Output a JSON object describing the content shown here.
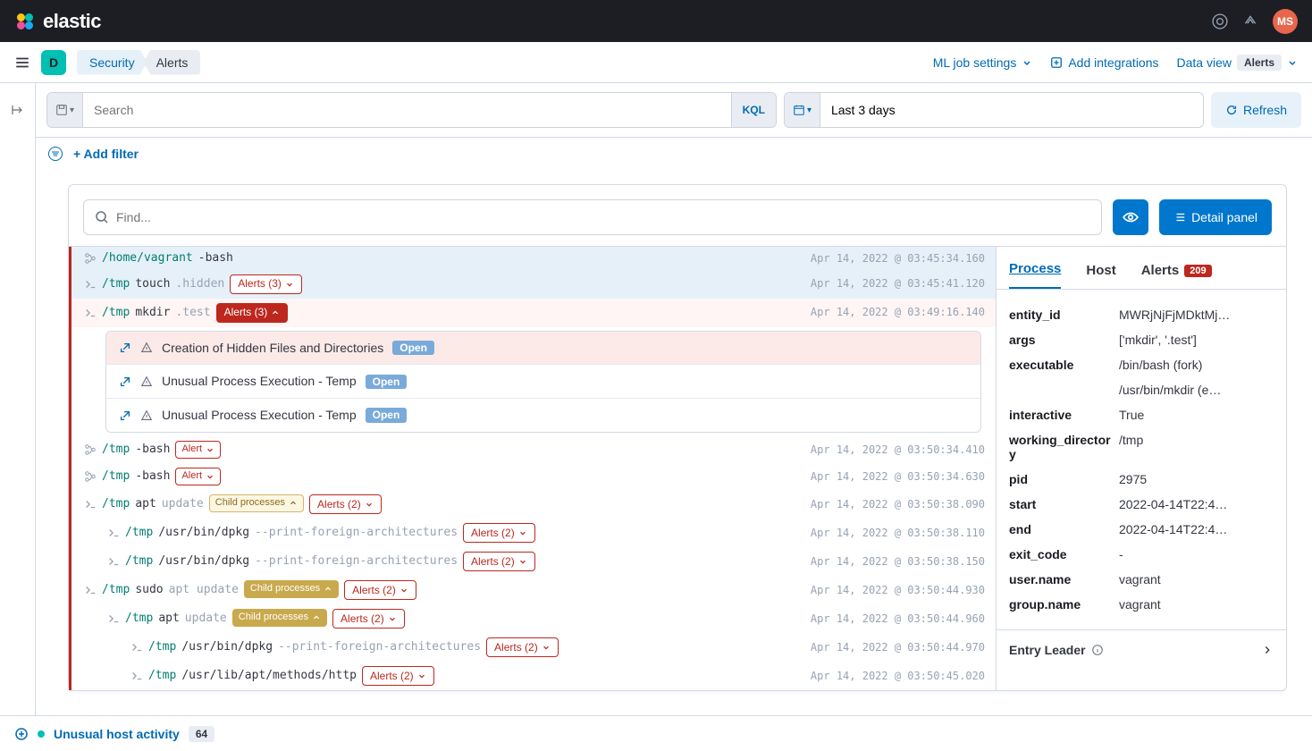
{
  "brand": "elastic",
  "avatar": "MS",
  "space": "D",
  "breadcrumbs": {
    "security": "Security",
    "alerts": "Alerts"
  },
  "header": {
    "ml": "ML job settings",
    "add_int": "Add integrations",
    "data_view": "Data view",
    "data_view_badge": "Alerts"
  },
  "query": {
    "placeholder": "Search",
    "suffix": "KQL",
    "date": "Last 3 days",
    "refresh": "Refresh",
    "add_filter": "+ Add filter"
  },
  "find": {
    "placeholder": "Find...",
    "detail": "Detail panel"
  },
  "rows": [
    {
      "indent": 0,
      "icon": "branch",
      "dir": "/home/vagrant",
      "cmd": "-bash",
      "arg": "",
      "ts": "Apr 14, 2022 @ 03:45:34.160",
      "hov": true
    },
    {
      "indent": 0,
      "icon": "prompt",
      "dir": "/tmp",
      "cmd": "touch",
      "arg": ".hidden",
      "ts": "Apr 14, 2022 @ 03:45:41.120",
      "alerts": "Alerts (3)",
      "alerts_open": true,
      "hov": true
    },
    {
      "indent": 0,
      "icon": "prompt",
      "dir": "/tmp",
      "cmd": "mkdir",
      "arg": ".test",
      "ts": "Apr 14, 2022 @ 03:49:16.140",
      "alerts": "Alerts (3)",
      "alerts_solid": true,
      "sel": true
    },
    {
      "indent": 0,
      "icon": "branch",
      "dir": "/tmp",
      "cmd": "-bash",
      "arg": "",
      "ts": "Apr 14, 2022 @ 03:50:34.410",
      "alert_single": "Alert"
    },
    {
      "indent": 0,
      "icon": "branch",
      "dir": "/tmp",
      "cmd": "-bash",
      "arg": "",
      "ts": "Apr 14, 2022 @ 03:50:34.630",
      "alert_single": "Alert"
    },
    {
      "indent": 0,
      "icon": "prompt",
      "dir": "/tmp",
      "cmd": "apt",
      "arg": "update",
      "ts": "Apr 14, 2022 @ 03:50:38.090",
      "child": "Child processes",
      "alerts": "Alerts (2)"
    },
    {
      "indent": 1,
      "icon": "prompt",
      "dir": "/tmp",
      "cmd": "/usr/bin/dpkg",
      "arg": "--print-foreign-architectures",
      "ts": "Apr 14, 2022 @ 03:50:38.110",
      "alerts": "Alerts (2)"
    },
    {
      "indent": 1,
      "icon": "prompt",
      "dir": "/tmp",
      "cmd": "/usr/bin/dpkg",
      "arg": "--print-foreign-architectures",
      "ts": "Apr 14, 2022 @ 03:50:38.150",
      "alerts": "Alerts (2)"
    },
    {
      "indent": 0,
      "icon": "prompt",
      "dir": "/tmp",
      "cmd": "sudo",
      "arg": "apt update",
      "ts": "Apr 14, 2022 @ 03:50:44.930",
      "child": "Child processes",
      "child_solid": true,
      "alerts": "Alerts (2)"
    },
    {
      "indent": 1,
      "icon": "prompt",
      "dir": "/tmp",
      "cmd": "apt",
      "arg": "update",
      "ts": "Apr 14, 2022 @ 03:50:44.960",
      "child": "Child processes",
      "child_solid": true,
      "alerts": "Alerts (2)"
    },
    {
      "indent": 2,
      "icon": "prompt",
      "dir": "/tmp",
      "cmd": "/usr/bin/dpkg",
      "arg": "--print-foreign-architectures",
      "ts": "Apr 14, 2022 @ 03:50:44.970",
      "alerts": "Alerts (2)"
    },
    {
      "indent": 2,
      "icon": "prompt",
      "dir": "/tmp",
      "cmd": "/usr/lib/apt/methods/http",
      "arg": "",
      "ts": "Apr 14, 2022 @ 03:50:45.020",
      "alerts": "Alerts (2)"
    }
  ],
  "alerts_expanded": [
    {
      "name": "Creation of Hidden Files and Directories",
      "status": "Open",
      "first": true
    },
    {
      "name": "Unusual Process Execution - Temp",
      "status": "Open"
    },
    {
      "name": "Unusual Process Execution - Temp",
      "status": "Open"
    }
  ],
  "detail": {
    "tabs": {
      "process": "Process",
      "host": "Host",
      "alerts": "Alerts",
      "alerts_count": "209"
    },
    "kv": [
      {
        "k": "entity_id",
        "v": "MWRjNjFjMDktMj…"
      },
      {
        "k": "args",
        "v": "['mkdir', '.test']"
      },
      {
        "k": "executable",
        "v": "/bin/bash (fork)"
      },
      {
        "k": "",
        "v": "/usr/bin/mkdir (e…"
      },
      {
        "k": "interactive",
        "v": "True"
      },
      {
        "k": "working_directory",
        "v": "/tmp"
      },
      {
        "k": "pid",
        "v": "2975"
      },
      {
        "k": "start",
        "v": "2022-04-14T22:4…"
      },
      {
        "k": "end",
        "v": "2022-04-14T22:4…"
      },
      {
        "k": "exit_code",
        "v": "-"
      },
      {
        "k": "user.name",
        "v": "vagrant"
      },
      {
        "k": "group.name",
        "v": "vagrant"
      }
    ],
    "entry_leader": "Entry Leader"
  },
  "footer": {
    "timeline": "Unusual host activity",
    "count": "64"
  }
}
